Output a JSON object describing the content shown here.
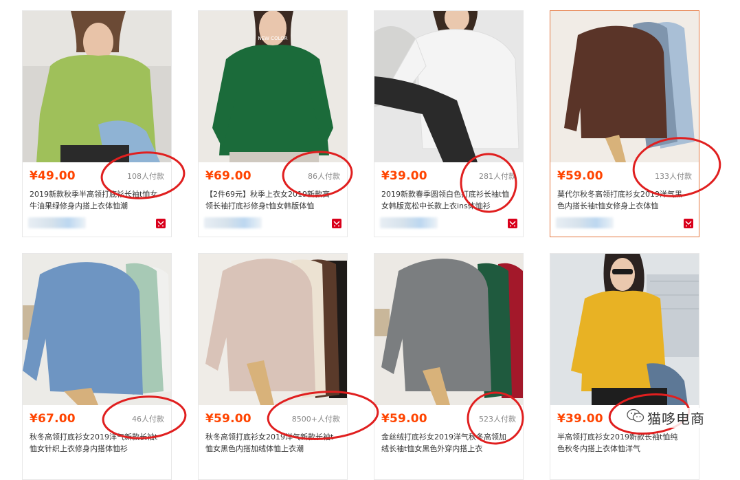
{
  "currency": "¥",
  "accent_color": "#ff4400",
  "annotation_color": "#e01f1f",
  "watermark": {
    "icon": "wechat-icon",
    "text": "猫哆电商"
  },
  "products": [
    {
      "price": "49.00",
      "sold": "108人付款",
      "title_line1": "2019新款秋季半高领打底衫长袖t恤女",
      "title_line2": "牛油果绿修身内搭上衣体恤潮",
      "shop_badge": "tmall-icon",
      "highlighted": false,
      "shirt_color": "#9fc05a"
    },
    {
      "price": "69.00",
      "sold": "86人付款",
      "title_line1": "【2件69元】秋季上衣女2019新款高",
      "title_line2": "领长袖打底衫修身t恤女韩版体恤",
      "shop_badge": "tmall-icon",
      "highlighted": false,
      "shirt_color": "#1b6b3a",
      "shirt_text": "NEW COLOR"
    },
    {
      "price": "39.00",
      "sold": "281人付款",
      "title_line1": "2019新款春季圆领白色打底衫长袖t恤",
      "title_line2": "女韩版宽松中长款上衣ins体恤衫",
      "shop_badge": "tmall-icon",
      "highlighted": false,
      "shirt_color": "#f4f4f4"
    },
    {
      "price": "59.00",
      "sold": "133人付款",
      "title_line1": "莫代尔秋冬高领打底衫女2019洋气黑",
      "title_line2": "色内搭长袖t恤女修身上衣体恤",
      "shop_badge": "tmall-icon",
      "highlighted": true,
      "shirt_color": "#5a3428"
    },
    {
      "price": "67.00",
      "sold": "46人付款",
      "title_line1": "秋冬高领打底衫女2019洋气新款长袖t",
      "title_line2": "恤女针织上衣修身内搭体恤衫",
      "shop_badge": "tmall-icon",
      "highlighted": false,
      "shirt_color": "#6e95c2"
    },
    {
      "price": "59.00",
      "sold": "8500+人付款",
      "title_line1": "秋冬高领打底衫女2019洋气新款长袖t",
      "title_line2": "恤女黑色内搭加绒体恤上衣潮",
      "shop_badge": "tmall-icon",
      "highlighted": false,
      "shirt_color": "#d9c3b8"
    },
    {
      "price": "59.00",
      "sold": "523人付款",
      "title_line1": "金丝绒打底衫女2019洋气秋冬高领加",
      "title_line2": "绒长袖t恤女黑色外穿内搭上衣",
      "shop_badge": "tmall-icon",
      "highlighted": false,
      "shirt_color": "#7b7e80"
    },
    {
      "price": "39.00",
      "sold": "",
      "title_line1": "半高领打底衫女2019新款长袖t恤纯",
      "title_line2": "色秋冬内搭上衣体恤洋气",
      "shop_badge": "tmall-icon",
      "highlighted": false,
      "shirt_color": "#e8b224"
    }
  ]
}
